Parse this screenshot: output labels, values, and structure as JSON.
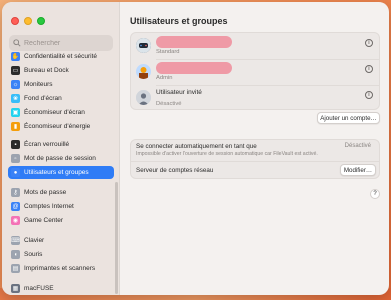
{
  "window": {
    "title": "Utilisateurs et groupes"
  },
  "search": {
    "placeholder": "Rechercher"
  },
  "sidebar": {
    "items": [
      {
        "label": "Confidentialité et sécurité",
        "icon": "hand-icon",
        "color": "#3b82f6"
      },
      {
        "label": "Bureau et Dock",
        "icon": "dock-icon",
        "color": "#2b2b2b"
      },
      {
        "label": "Moniteurs",
        "icon": "display-icon",
        "color": "#3b82f6"
      },
      {
        "label": "Fond d'écran",
        "icon": "wallpaper-icon",
        "color": "#38bdf8"
      },
      {
        "label": "Économiseur d'écran",
        "icon": "screensaver-icon",
        "color": "#22d3ee"
      },
      {
        "label": "Économiseur d'énergie",
        "icon": "battery-icon",
        "color": "#f59e0b"
      },
      {
        "label": "Écran verrouillé",
        "icon": "lock-icon",
        "color": "#2b2b2b"
      },
      {
        "label": "Mot de passe de session",
        "icon": "lock-screen-icon",
        "color": "#9ca3af"
      },
      {
        "label": "Utilisateurs et groupes",
        "icon": "users-icon",
        "color": "#3b82f6"
      },
      {
        "label": "Mots de passe",
        "icon": "key-icon",
        "color": "#9ca3af"
      },
      {
        "label": "Comptes Internet",
        "icon": "at-icon",
        "color": "#3b82f6"
      },
      {
        "label": "Game Center",
        "icon": "game-center-icon",
        "color": "#f472b6"
      },
      {
        "label": "Clavier",
        "icon": "keyboard-icon",
        "color": "#9ca3af"
      },
      {
        "label": "Souris",
        "icon": "mouse-icon",
        "color": "#9ca3af"
      },
      {
        "label": "Imprimantes et scanners",
        "icon": "printer-icon",
        "color": "#9ca3af"
      },
      {
        "label": "macFUSE",
        "icon": "macfuse-icon",
        "color": "#6b7280"
      }
    ]
  },
  "users": [
    {
      "role": "Standard"
    },
    {
      "role": "Admin"
    },
    {
      "name": "Utilisateur invité",
      "role": "Désactivé"
    }
  ],
  "add_account_button": "Ajouter un compte…",
  "auto_login": {
    "label": "Se connecter automatiquement en tant que",
    "value": "Désactivé",
    "note": "Impossible d'activer l'ouverture de session automatique car FileVault est activé."
  },
  "network_server": {
    "label": "Serveur de comptes réseau",
    "button": "Modifier…"
  },
  "help_button": "?",
  "accent_color": "#2f7cf6",
  "redaction_color": "#ef9aa6"
}
